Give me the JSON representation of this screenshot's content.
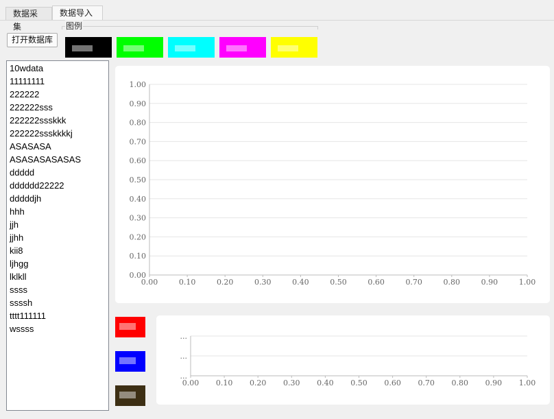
{
  "tabs": [
    {
      "label": "数据采集"
    },
    {
      "label": "数据导入"
    }
  ],
  "toolbar": {
    "open_db_label": "打开数据库"
  },
  "legend": {
    "title": "图例",
    "swatches": [
      {
        "color": "#000000"
      },
      {
        "color": "#00ff00"
      },
      {
        "color": "#00ffff"
      },
      {
        "color": "#ff00ff"
      },
      {
        "color": "#ffff00"
      }
    ]
  },
  "datasets": [
    "10wdata",
    "11111111",
    "222222",
    "222222sss",
    "222222ssskkk",
    "222222ssskkkkj",
    "ASASASA",
    "ASASASASASAS",
    "ddddd",
    "dddddd22222",
    "dddddjh",
    "hhh",
    "jjh",
    "jjhh",
    "kii8",
    "ljhgg",
    "lklkll",
    "ssss",
    "ssssh",
    "tttt111111",
    "wssss"
  ],
  "side_colors": [
    "#ff0000",
    "#0000ff",
    "#3d2f14"
  ],
  "chart_data": [
    {
      "type": "line",
      "xlim": [
        0,
        1
      ],
      "ylim": [
        0,
        1
      ],
      "x_ticks": [
        "0.00",
        "0.10",
        "0.20",
        "0.30",
        "0.40",
        "0.50",
        "0.60",
        "0.70",
        "0.80",
        "0.90",
        "1.00"
      ],
      "y_ticks": [
        "0.00",
        "0.10",
        "0.20",
        "0.30",
        "0.40",
        "0.50",
        "0.60",
        "0.70",
        "0.80",
        "0.90",
        "1.00"
      ],
      "grid": true,
      "series": []
    },
    {
      "type": "line",
      "xlim": [
        0,
        1
      ],
      "x_ticks": [
        "0.00",
        "0.10",
        "0.20",
        "0.30",
        "0.40",
        "0.50",
        "0.60",
        "0.70",
        "0.80",
        "0.90",
        "1.00"
      ],
      "y_ticks": [
        "...",
        "...",
        "..."
      ],
      "grid": true,
      "series": []
    }
  ]
}
